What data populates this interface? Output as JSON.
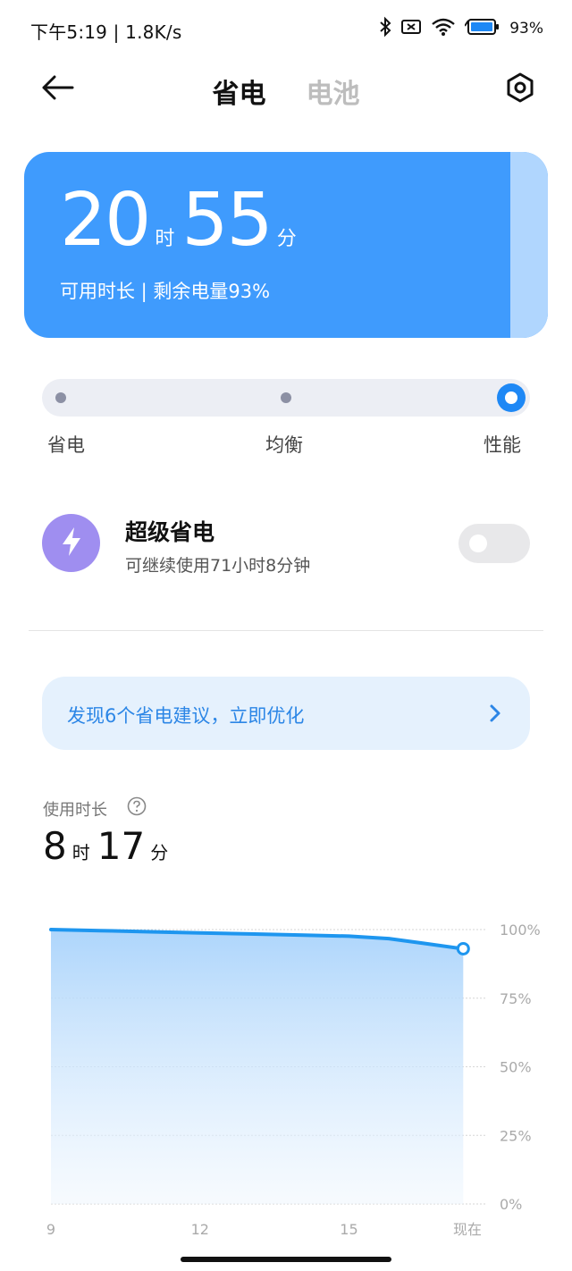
{
  "status_bar": {
    "time_speed": "下午5:19 | 1.8K/s",
    "battery_percent": "93%",
    "icons": [
      "bluetooth-icon",
      "no-sim-icon",
      "wifi-icon",
      "battery-charging-icon"
    ]
  },
  "header": {
    "back_icon": "arrow-left-icon",
    "tabs": [
      {
        "label": "省电",
        "active": true
      },
      {
        "label": "电池",
        "active": false
      }
    ],
    "settings_icon": "gear-icon"
  },
  "battery_card": {
    "hours": "20",
    "hours_unit": "时",
    "minutes": "55",
    "minutes_unit": "分",
    "subtitle": "可用时长 | 剩余电量93%",
    "color": "#3f9bfd"
  },
  "mode_selector": {
    "options": [
      "省电",
      "均衡",
      "性能"
    ],
    "selected": "性能",
    "accent": "#1e88f5"
  },
  "super_saver": {
    "icon": "lightning-bolt-icon",
    "title": "超级省电",
    "subtitle": "可继续使用71小时8分钟",
    "enabled": false
  },
  "suggestion": {
    "text": "发现6个省电建议，立即优化",
    "arrow_icon": "chevron-right-icon"
  },
  "usage": {
    "label": "使用时长",
    "help_icon": "question-circle-icon",
    "hours": "8",
    "hours_unit": "时",
    "minutes": "17",
    "minutes_unit": "分"
  },
  "chart_data": {
    "type": "area",
    "x": [
      9,
      10,
      11,
      12,
      13,
      14,
      15,
      15.8,
      16.5,
      17.3
    ],
    "values": [
      100,
      99.6,
      99.2,
      98.8,
      98.4,
      98.0,
      97.6,
      96.7,
      95,
      93
    ],
    "x_ticks": [
      "9",
      "12",
      "15",
      "现在"
    ],
    "x_tick_values": [
      9,
      12,
      15,
      17.6
    ],
    "y_ticks": [
      "100%",
      "75%",
      "50%",
      "25%",
      "0%"
    ],
    "y_tick_values": [
      100,
      75,
      50,
      25,
      0
    ],
    "ylim": [
      0,
      100
    ],
    "xlim": [
      9,
      17.6
    ],
    "grid": true,
    "line_color": "#1e96ef"
  }
}
